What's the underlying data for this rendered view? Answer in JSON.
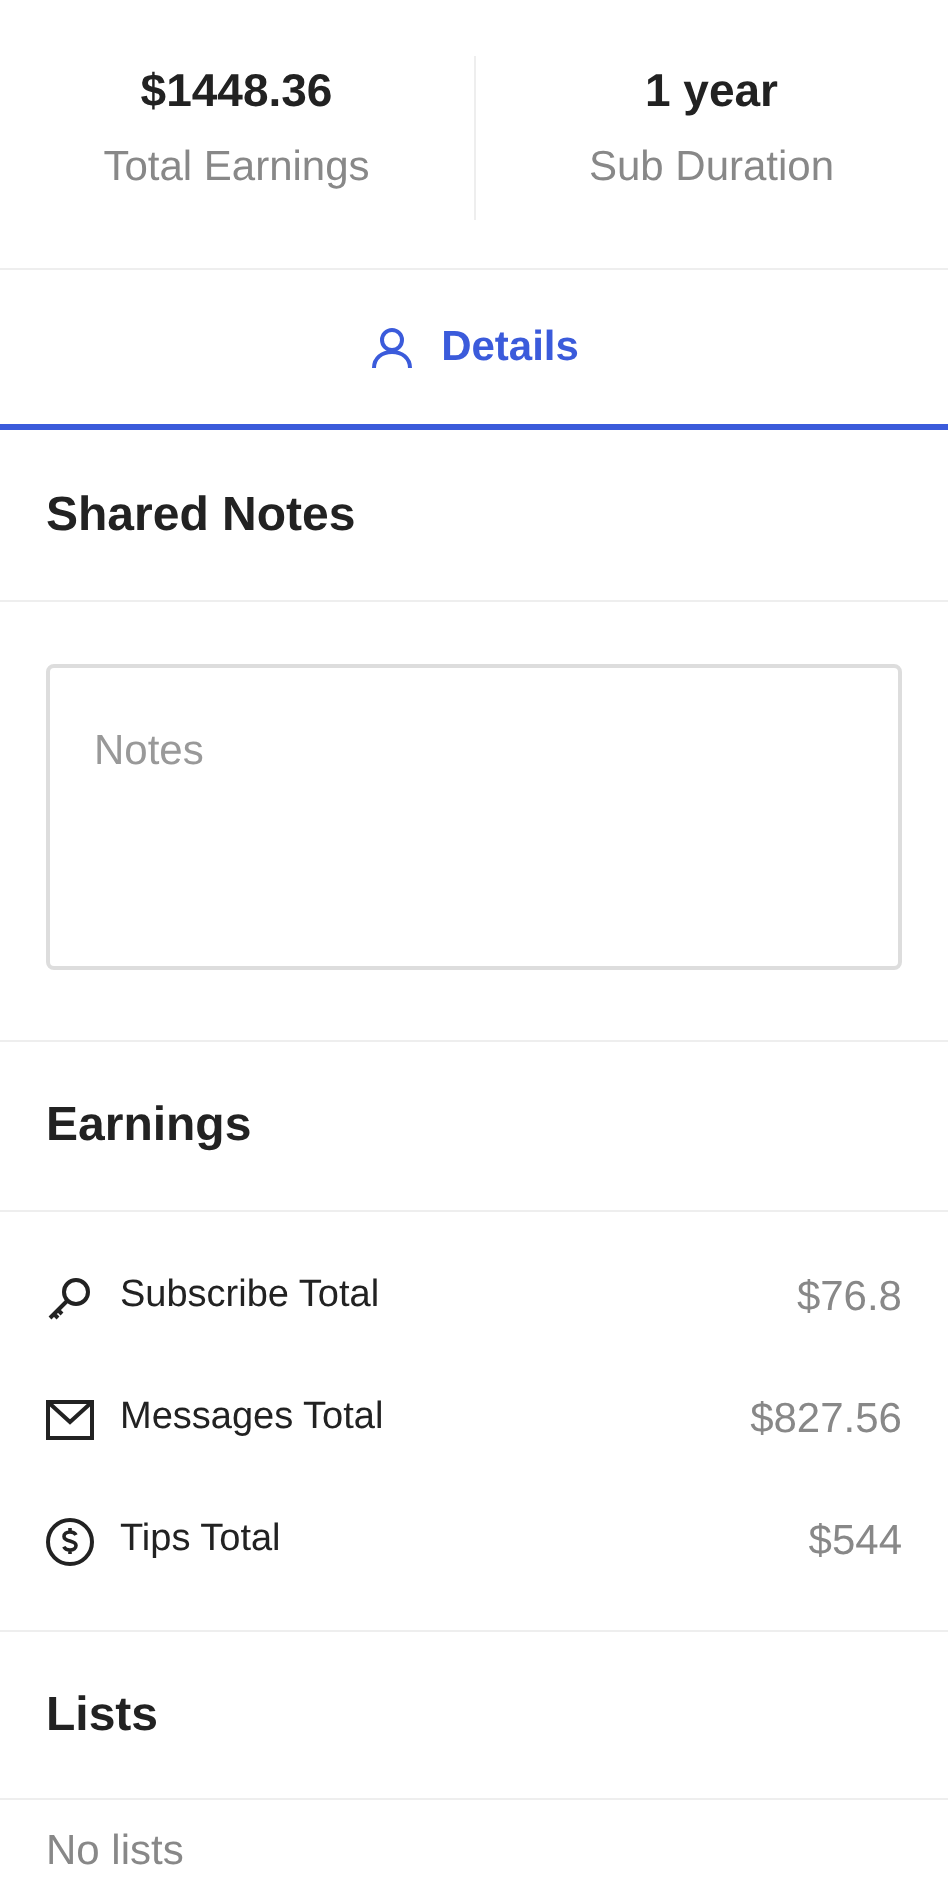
{
  "stats": [
    {
      "value": "$1448.36",
      "label": "Total Earnings"
    },
    {
      "value": "1 year",
      "label": "Sub Duration"
    }
  ],
  "tabs": [
    {
      "label": "Details",
      "selected": true
    }
  ],
  "shared_notes": {
    "title": "Shared Notes",
    "placeholder": "Notes"
  },
  "earnings": {
    "title": "Earnings",
    "rows": [
      {
        "kind": "key",
        "label": "Subscribe Total",
        "amount": "$76.8"
      },
      {
        "kind": "mail",
        "label": "Messages Total",
        "amount": "$827.56"
      },
      {
        "kind": "dollar",
        "label": "Tips Total",
        "amount": "$544"
      }
    ]
  },
  "lists": {
    "title": "Lists",
    "empty_text": "No lists"
  }
}
